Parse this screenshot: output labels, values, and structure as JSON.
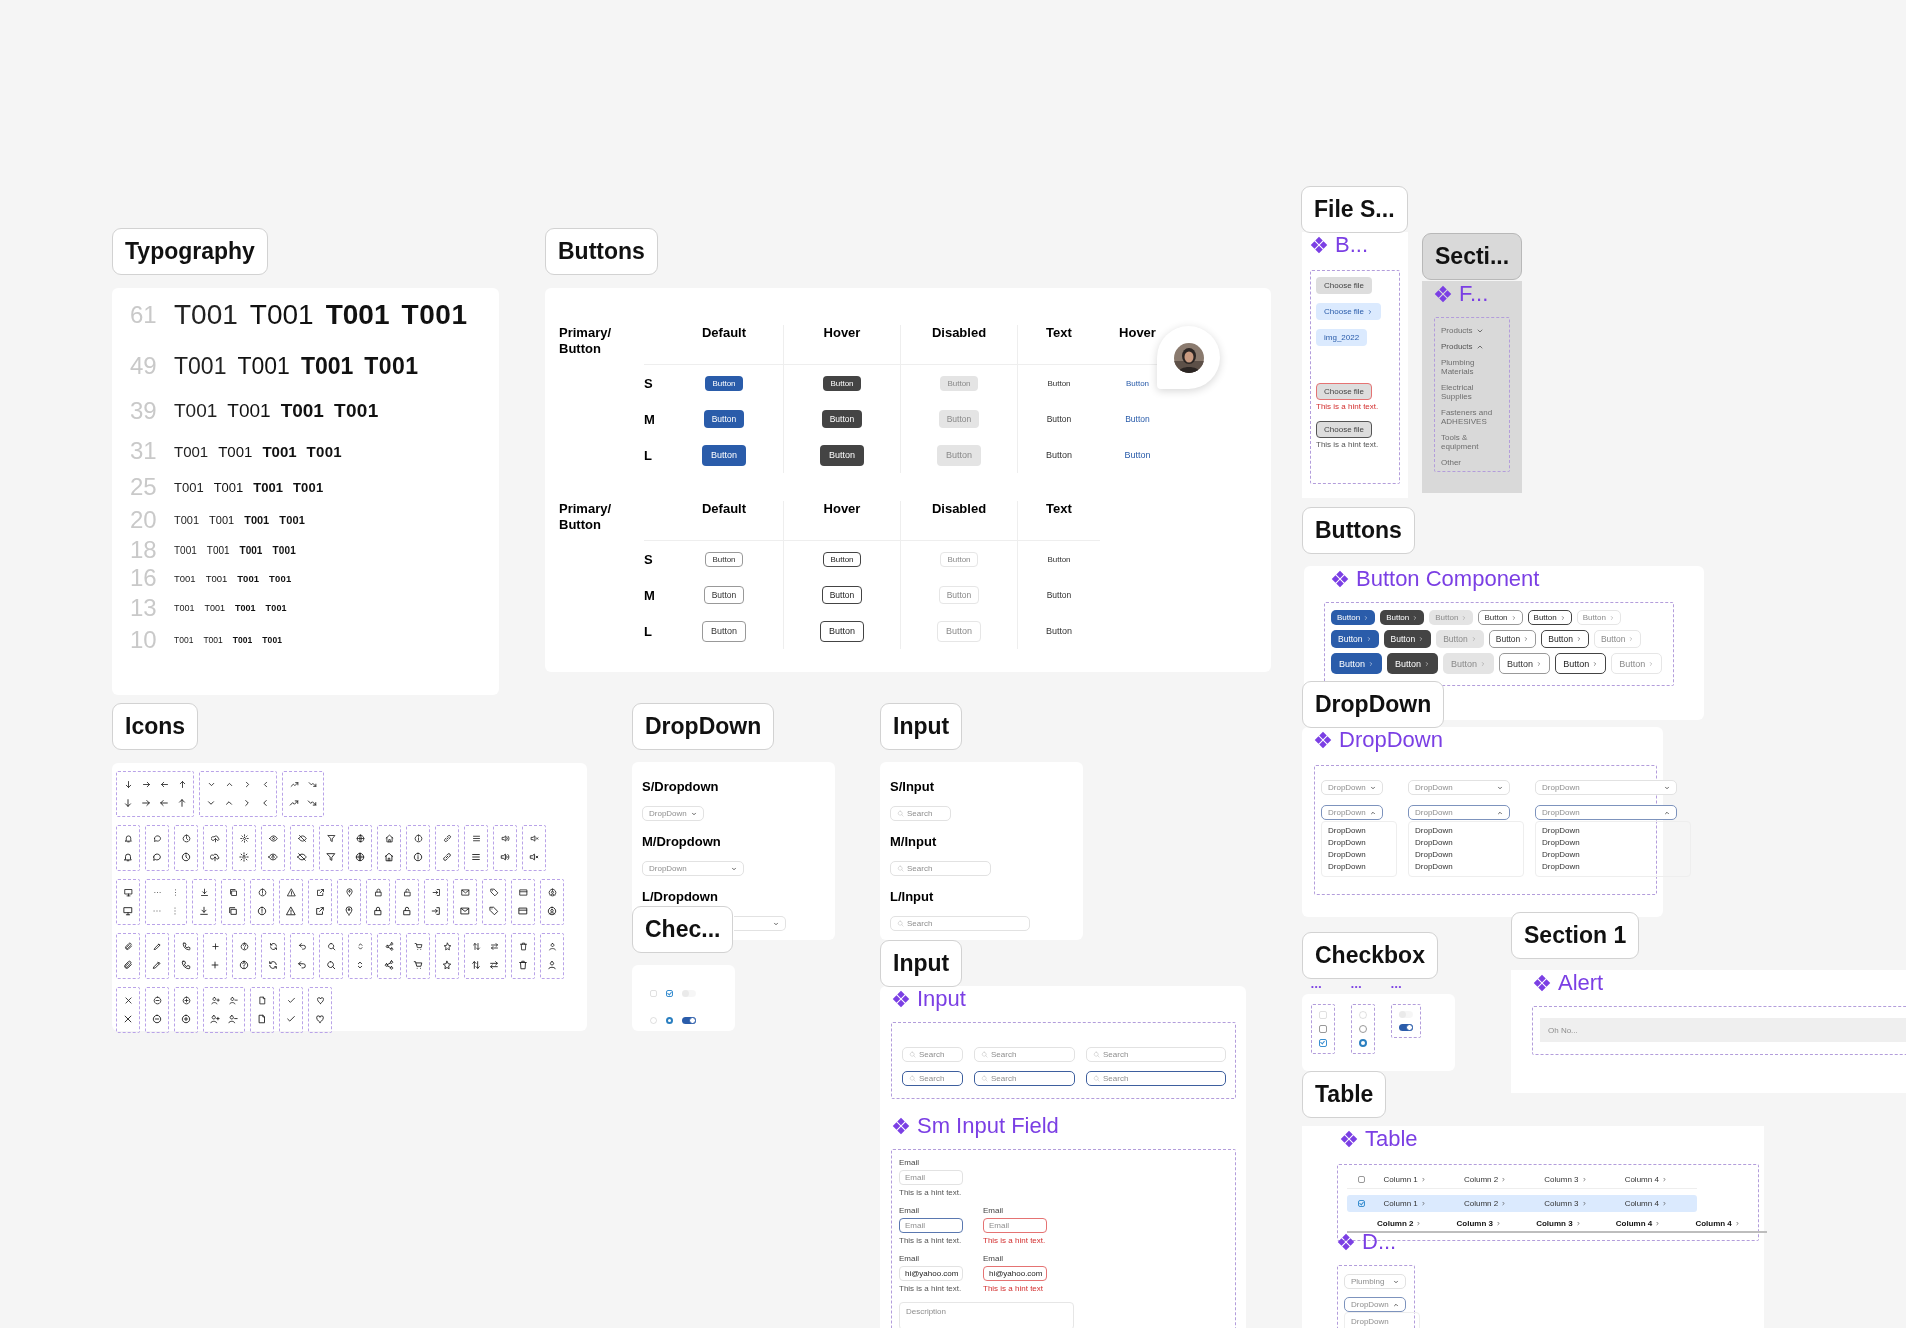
{
  "labels": [
    {
      "text": "Typography",
      "kind": "plain"
    },
    {
      "text": "Buttons",
      "kind": "plain"
    },
    {
      "text": "Icons",
      "kind": "plain"
    },
    {
      "text": "DropDown",
      "kind": "plain"
    },
    {
      "text": "Input",
      "kind": "plain"
    },
    {
      "text": "Chec...",
      "kind": "plain"
    },
    {
      "text": "Input",
      "kind": "plain"
    },
    {
      "text": "File S...",
      "kind": "plain"
    },
    {
      "text": "Secti...",
      "kind": "grey"
    },
    {
      "text": "Buttons",
      "kind": "plain"
    },
    {
      "text": "DropDown",
      "kind": "plain"
    },
    {
      "text": "Checkbox",
      "kind": "plain"
    },
    {
      "text": "Section 1",
      "kind": "plain"
    },
    {
      "text": "Table",
      "kind": "plain"
    }
  ],
  "typography": {
    "rows": [
      {
        "number": "61",
        "samples": [
          "T001",
          "T001",
          "T001",
          "T001"
        ]
      },
      {
        "number": "49",
        "samples": [
          "T001",
          "T001",
          "T001",
          "T001"
        ]
      },
      {
        "number": "39",
        "samples": [
          "T001",
          "T001",
          "T001",
          "T001"
        ]
      },
      {
        "number": "31",
        "samples": [
          "T001",
          "T001",
          "T001",
          "T001"
        ]
      },
      {
        "number": "25",
        "samples": [
          "T001",
          "T001",
          "T001",
          "T001"
        ]
      },
      {
        "number": "20",
        "samples": [
          "T001",
          "T001",
          "T001",
          "T001"
        ]
      },
      {
        "number": "18",
        "samples": [
          "T001",
          "T001",
          "T001",
          "T001"
        ]
      },
      {
        "number": "16",
        "samples": [
          "T001",
          "T001",
          "T001",
          "T001"
        ]
      },
      {
        "number": "13",
        "samples": [
          "T001",
          "T001",
          "T001",
          "T001"
        ]
      },
      {
        "number": "10",
        "samples": [
          "T001",
          "T001",
          "T001",
          "T001"
        ]
      }
    ]
  },
  "button_tables": [
    {
      "title": "Primary/ Button",
      "columns": [
        "Default",
        "Hover",
        "Disabled",
        "Text",
        "Hover"
      ],
      "rows": [
        {
          "size": "S",
          "buttons": [
            {
              "kind": "filled",
              "label": "Button"
            },
            {
              "kind": "dark",
              "label": "Button"
            },
            {
              "kind": "disabled",
              "label": "Button"
            },
            {
              "kind": "text",
              "label": "Button"
            },
            {
              "kind": "link",
              "label": "Button"
            }
          ]
        },
        {
          "size": "M",
          "buttons": [
            {
              "kind": "filled",
              "label": "Button"
            },
            {
              "kind": "dark",
              "label": "Button"
            },
            {
              "kind": "disabled",
              "label": "Button"
            },
            {
              "kind": "text",
              "label": "Button"
            },
            {
              "kind": "link",
              "label": "Button"
            }
          ]
        },
        {
          "size": "L",
          "buttons": [
            {
              "kind": "filled",
              "label": "Button"
            },
            {
              "kind": "dark",
              "label": "Button"
            },
            {
              "kind": "disabled",
              "label": "Button"
            },
            {
              "kind": "text",
              "label": "Button"
            },
            {
              "kind": "link",
              "label": "Button"
            }
          ]
        }
      ]
    },
    {
      "title": "Primary/ Button",
      "columns": [
        "Default",
        "Hover",
        "Disabled",
        "Text"
      ],
      "rows": [
        {
          "size": "S",
          "buttons": [
            {
              "kind": "outline",
              "label": "Button"
            },
            {
              "kind": "outline-hover",
              "label": "Button"
            },
            {
              "kind": "outline-disabled",
              "label": "Button"
            },
            {
              "kind": "text",
              "label": "Button"
            }
          ]
        },
        {
          "size": "M",
          "buttons": [
            {
              "kind": "outline",
              "label": "Button"
            },
            {
              "kind": "outline-hover",
              "label": "Button"
            },
            {
              "kind": "outline-disabled",
              "label": "Button"
            },
            {
              "kind": "text",
              "label": "Button"
            }
          ]
        },
        {
          "size": "L",
          "buttons": [
            {
              "kind": "outline",
              "label": "Button"
            },
            {
              "kind": "outline-hover",
              "label": "Button"
            },
            {
              "kind": "outline-disabled",
              "label": "Button"
            },
            {
              "kind": "text",
              "label": "Button"
            }
          ]
        }
      ]
    }
  ],
  "dropdown_sizes": [
    {
      "label": "S/Dropdown",
      "kind": "small",
      "placeholder": "DropDown"
    },
    {
      "label": "M/Dropdown",
      "kind": "medium",
      "placeholder": "DropDown"
    },
    {
      "label": "L/Dropdown",
      "kind": "large"
    }
  ],
  "input_sizes": [
    {
      "label": "S/Input",
      "kind": "small",
      "placeholder": "Search"
    },
    {
      "label": "M/Input",
      "kind": "medium",
      "placeholder": "Search"
    },
    {
      "label": "L/Input",
      "kind": "large",
      "placeholder": "Search"
    }
  ],
  "toggles": [
    {
      "kind": "checkbox",
      "checked": false,
      "disabled": true
    },
    {
      "kind": "checkbox",
      "checked": true,
      "disabled": false
    },
    {
      "kind": "toggle",
      "on": false,
      "disabled": true
    },
    {
      "kind": "radio",
      "selected": false,
      "disabled": true
    },
    {
      "kind": "radio",
      "selected": true,
      "disabled": false
    },
    {
      "kind": "toggle",
      "on": true,
      "disabled": false
    }
  ],
  "input_component": {
    "title": "Input",
    "rows": [
      [
        {
          "kind": "small",
          "placeholder": "Search",
          "focused": false
        },
        {
          "kind": "medium",
          "placeholder": "Search",
          "focused": false
        },
        {
          "kind": "large",
          "placeholder": "Search",
          "focused": false
        }
      ],
      [
        {
          "kind": "small",
          "placeholder": "Search",
          "focused": true
        },
        {
          "kind": "medium",
          "placeholder": "Search",
          "focused": true
        },
        {
          "kind": "large",
          "placeholder": "Search",
          "focused": true
        }
      ]
    ]
  },
  "sm_input": {
    "title": "Sm Input Field",
    "rows": [
      [
        {
          "label": "Email",
          "placeholder": "Email",
          "hint": "This is a hint text.",
          "kind": "default"
        }
      ],
      [
        {
          "label": "Email",
          "placeholder": "Email",
          "hint": "This is a hint text.",
          "kind": "focus"
        },
        {
          "label": "Email",
          "placeholder": "Email",
          "hint": "This is a hint text.",
          "kind": "error"
        }
      ],
      [
        {
          "label": "Email",
          "value": "hi@yahoo.com",
          "hint": "This is a hint text.",
          "kind": "default"
        },
        {
          "label": "Email",
          "value": "hi@yahoo.com",
          "hint": "This is a hint text",
          "kind": "error"
        }
      ]
    ],
    "description": {
      "placeholder": "Description"
    }
  },
  "file_component": {
    "title": "B...",
    "items": [
      {
        "kind": "grey",
        "label": "Choose file"
      },
      {
        "kind": "light",
        "label": "Choose file"
      },
      {
        "kind": "chip",
        "label": "img_2022"
      },
      {
        "kind": "error",
        "label": "Choose file",
        "hint": "This is a hint text."
      },
      {
        "kind": "outlined",
        "label": "Choose file",
        "hint": "This is a hint text."
      }
    ]
  },
  "menu_component": {
    "title": "F...",
    "items": [
      {
        "kind": "group",
        "label": "Products",
        "expanded": false
      },
      {
        "kind": "group",
        "label": "Products",
        "expanded": true
      },
      {
        "kind": "item",
        "label": "Plumbing Materials"
      },
      {
        "kind": "item",
        "label": "Electrical Supplies"
      },
      {
        "kind": "item",
        "label": "Fasteners and ADHESIVES"
      },
      {
        "kind": "item",
        "label": "Tools & equipment"
      },
      {
        "kind": "item",
        "label": "Other"
      }
    ]
  },
  "button_component": {
    "title": "Button Component",
    "rows": [
      {
        "kind": "small",
        "buttons": [
          {
            "kind": "filled",
            "label": "Button"
          },
          {
            "kind": "dark",
            "label": "Button"
          },
          {
            "kind": "disabled",
            "label": "Button"
          },
          {
            "kind": "outline",
            "label": "Button"
          },
          {
            "kind": "outline-hover",
            "label": "Button"
          },
          {
            "kind": "outline-disabled",
            "label": "Button"
          }
        ]
      },
      {
        "kind": "medium",
        "buttons": [
          {
            "kind": "filled",
            "label": "Button"
          },
          {
            "kind": "dark",
            "label": "Button"
          },
          {
            "kind": "disabled",
            "label": "Button"
          },
          {
            "kind": "outline",
            "label": "Button"
          },
          {
            "kind": "outline-hover",
            "label": "Button"
          },
          {
            "kind": "outline-disabled",
            "label": "Button"
          }
        ]
      },
      {
        "kind": "large",
        "buttons": [
          {
            "kind": "filled",
            "label": "Button"
          },
          {
            "kind": "dark",
            "label": "Button"
          },
          {
            "kind": "disabled",
            "label": "Button"
          },
          {
            "kind": "outline",
            "label": "Button"
          },
          {
            "kind": "outline-hover",
            "label": "Button"
          },
          {
            "kind": "outline-disabled",
            "label": "Button"
          }
        ]
      }
    ]
  },
  "dropdown_component": {
    "title": "DropDown",
    "columns": [
      {
        "kind": "small",
        "closed": {
          "placeholder": "DropDown"
        },
        "open": {
          "placeholder": "DropDown",
          "options": [
            "DropDown",
            "DropDown",
            "DropDown",
            "DropDown"
          ]
        }
      },
      {
        "kind": "medium",
        "closed": {
          "placeholder": "DropDown"
        },
        "open": {
          "placeholder": "DropDown",
          "options": [
            "DropDown",
            "DropDown",
            "DropDown",
            "DropDown"
          ]
        }
      },
      {
        "kind": "large",
        "closed": {
          "placeholder": "DropDown"
        },
        "open": {
          "placeholder": "DropDown",
          "options": [
            "DropDown",
            "DropDown",
            "DropDown",
            "DropDown"
          ]
        }
      }
    ]
  },
  "checkbox_component": {
    "groups": [
      {
        "label": "•••",
        "items": [
          {
            "kind": "checkbox",
            "checked": false,
            "disabled": true
          },
          {
            "kind": "checkbox",
            "checked": false,
            "disabled": false
          },
          {
            "kind": "checkbox",
            "checked": true,
            "disabled": false
          }
        ]
      },
      {
        "label": "•••",
        "items": [
          {
            "kind": "radio",
            "selected": false,
            "disabled": true
          },
          {
            "kind": "radio",
            "selected": false,
            "disabled": false
          },
          {
            "kind": "radio",
            "selected": true,
            "disabled": false
          }
        ]
      },
      {
        "label": "•••",
        "items": [
          {
            "kind": "toggle",
            "on": false,
            "disabled": true
          },
          {
            "kind": "toggle",
            "on": true,
            "disabled": false
          }
        ]
      }
    ]
  },
  "alert": {
    "title": "Alert",
    "message": "Oh No..."
  },
  "table": {
    "title": "Table",
    "rows": [
      {
        "kind": "header",
        "selected": false,
        "checked": false,
        "cells": [
          "Column 1",
          "Column 2",
          "Column 3",
          "Column 4"
        ]
      },
      {
        "kind": "body",
        "selected": true,
        "checked": true,
        "cells": [
          "Column 1",
          "Column 2",
          "Column 3",
          "Column 4"
        ]
      },
      {
        "kind": "heading",
        "selected": false,
        "cells": [
          "Column 2",
          "Column 3",
          "Column 3",
          "Column 4",
          "Column 4"
        ]
      }
    ]
  },
  "dropdown_small": {
    "title": "D...",
    "closed": {
      "placeholder": "Plumbing"
    },
    "open": {
      "placeholder": "DropDown",
      "options": [
        "DropDown"
      ]
    }
  }
}
